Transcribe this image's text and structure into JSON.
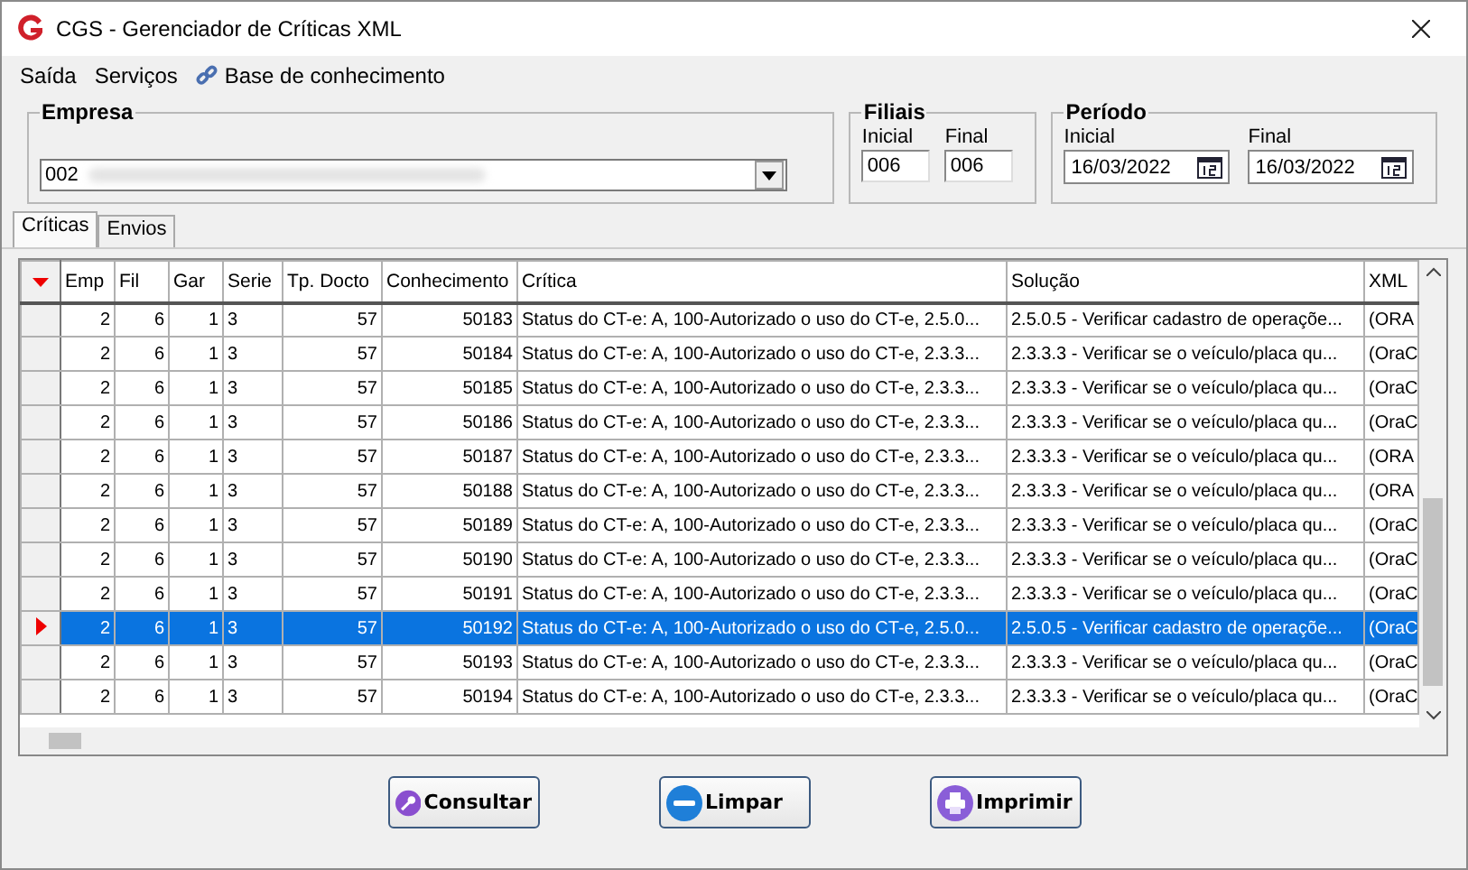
{
  "window": {
    "title": "CGS - Gerenciador de Críticas XML"
  },
  "menu": [
    {
      "label": "Saída",
      "kind": "plain"
    },
    {
      "label": "Serviços",
      "kind": "plain"
    },
    {
      "label": "Base de conhecimento",
      "kind": "link"
    }
  ],
  "empresa": {
    "label": "Empresa",
    "value": "002"
  },
  "filiais": {
    "label": "Filiais",
    "fields": [
      {
        "label": "Inicial",
        "value": "006"
      },
      {
        "label": "Final",
        "value": "006"
      }
    ]
  },
  "periodo": {
    "label": "Período",
    "fields": [
      {
        "label": "Inicial",
        "value": "16/03/2022"
      },
      {
        "label": "Final",
        "value": "16/03/2022"
      }
    ]
  },
  "tabs": [
    {
      "label": "Críticas",
      "selected": true
    },
    {
      "label": "Envios",
      "selected": false
    }
  ],
  "table": {
    "columns": [
      "Emp",
      "Fil",
      "Gar",
      "Serie",
      "Tp. Docto",
      "Conhecimento",
      "Crítica",
      "Solução",
      "XML"
    ],
    "rows": [
      {
        "selected": false,
        "cells": [
          "2",
          "6",
          "1",
          "3",
          "57",
          "50183",
          "Status do CT-e: A, 100-Autorizado o uso do CT-e, 2.5.0...",
          "2.5.0.5 - Verificar cadastro de operaçõe...",
          "(ORA"
        ]
      },
      {
        "selected": false,
        "cells": [
          "2",
          "6",
          "1",
          "3",
          "57",
          "50184",
          "Status do CT-e: A, 100-Autorizado o uso do CT-e, 2.3.3...",
          "2.3.3.3 - Verificar se o veículo/placa qu...",
          "(OraC"
        ]
      },
      {
        "selected": false,
        "cells": [
          "2",
          "6",
          "1",
          "3",
          "57",
          "50185",
          "Status do CT-e: A, 100-Autorizado o uso do CT-e, 2.3.3...",
          "2.3.3.3 - Verificar se o veículo/placa qu...",
          "(OraC"
        ]
      },
      {
        "selected": false,
        "cells": [
          "2",
          "6",
          "1",
          "3",
          "57",
          "50186",
          "Status do CT-e: A, 100-Autorizado o uso do CT-e, 2.3.3...",
          "2.3.3.3 - Verificar se o veículo/placa qu...",
          "(OraC"
        ]
      },
      {
        "selected": false,
        "cells": [
          "2",
          "6",
          "1",
          "3",
          "57",
          "50187",
          "Status do CT-e: A, 100-Autorizado o uso do CT-e, 2.3.3...",
          "2.3.3.3 - Verificar se o veículo/placa qu...",
          "(ORA"
        ]
      },
      {
        "selected": false,
        "cells": [
          "2",
          "6",
          "1",
          "3",
          "57",
          "50188",
          "Status do CT-e: A, 100-Autorizado o uso do CT-e, 2.3.3...",
          "2.3.3.3 - Verificar se o veículo/placa qu...",
          "(ORA"
        ]
      },
      {
        "selected": false,
        "cells": [
          "2",
          "6",
          "1",
          "3",
          "57",
          "50189",
          "Status do CT-e: A, 100-Autorizado o uso do CT-e, 2.3.3...",
          "2.3.3.3 - Verificar se o veículo/placa qu...",
          "(OraC"
        ]
      },
      {
        "selected": false,
        "cells": [
          "2",
          "6",
          "1",
          "3",
          "57",
          "50190",
          "Status do CT-e: A, 100-Autorizado o uso do CT-e, 2.3.3...",
          "2.3.3.3 - Verificar se o veículo/placa qu...",
          "(OraC"
        ]
      },
      {
        "selected": false,
        "cells": [
          "2",
          "6",
          "1",
          "3",
          "57",
          "50191",
          "Status do CT-e: A, 100-Autorizado o uso do CT-e, 2.3.3...",
          "2.3.3.3 - Verificar se o veículo/placa qu...",
          "(OraC"
        ]
      },
      {
        "selected": true,
        "cells": [
          "2",
          "6",
          "1",
          "3",
          "57",
          "50192",
          "Status do CT-e: A, 100-Autorizado o uso do CT-e, 2.5.0...",
          "2.5.0.5 - Verificar cadastro de operaçõe...",
          "(OraC"
        ]
      },
      {
        "selected": false,
        "cells": [
          "2",
          "6",
          "1",
          "3",
          "57",
          "50193",
          "Status do CT-e: A, 100-Autorizado o uso do CT-e, 2.3.3...",
          "2.3.3.3 - Verificar se o veículo/placa qu...",
          "(OraC"
        ]
      },
      {
        "selected": false,
        "cells": [
          "2",
          "6",
          "1",
          "3",
          "57",
          "50194",
          "Status do CT-e: A, 100-Autorizado o uso do CT-e, 2.3.3...",
          "2.3.3.3 - Verificar se o veículo/placa qu...",
          "(OraC"
        ]
      }
    ]
  },
  "buttons": [
    {
      "label": "Consultar",
      "kind": "search"
    },
    {
      "label": "Limpar",
      "kind": "clear"
    },
    {
      "label": "Imprimir",
      "kind": "print"
    }
  ]
}
